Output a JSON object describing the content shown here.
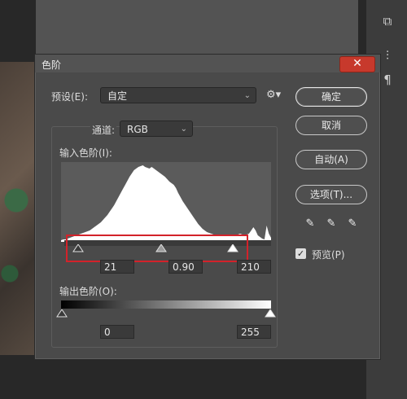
{
  "dialog": {
    "title": "色阶",
    "close_glyph": "✕",
    "preset_label": "预设(E):",
    "preset_value": "自定",
    "gear_icon": "gear-icon",
    "channel_label": "通道:",
    "channel_value": "RGB",
    "input_levels_label": "输入色阶(I):",
    "input_shadow": "21",
    "input_midtone": "0.90",
    "input_highlight": "210",
    "output_levels_label": "输出色阶(O):",
    "output_shadow": "0",
    "output_highlight": "255",
    "buttons": {
      "ok": "确定",
      "cancel": "取消",
      "auto": "自动(A)",
      "options": "选项(T)..."
    },
    "preview_label": "预览(P)",
    "preview_checked": true,
    "histogram": {
      "values": [
        2,
        3,
        3,
        4,
        5,
        6,
        7,
        8,
        9,
        10,
        11,
        12,
        13,
        14,
        16,
        18,
        20,
        22,
        24,
        27,
        30,
        33,
        37,
        41,
        45,
        50,
        55,
        60,
        65,
        70,
        75,
        80,
        84,
        88,
        90,
        92,
        93,
        94,
        92,
        91,
        90,
        92,
        90,
        88,
        86,
        84,
        82,
        80,
        77,
        74,
        72,
        70,
        66,
        60,
        55,
        50,
        46,
        42,
        38,
        34,
        30,
        26,
        22,
        19,
        16,
        14,
        12,
        11,
        10,
        9,
        9,
        8,
        8,
        8,
        8,
        7,
        7,
        7,
        8,
        8,
        9,
        10,
        9,
        8,
        9,
        10,
        14,
        18,
        14,
        8,
        6,
        4,
        3,
        20,
        10,
        5
      ]
    }
  },
  "colors": {
    "dialog_bg": "#4a4a4a",
    "close_red": "#c7392c",
    "highlight_red": "#d3222a",
    "histogram_fill": "#ffffff"
  }
}
